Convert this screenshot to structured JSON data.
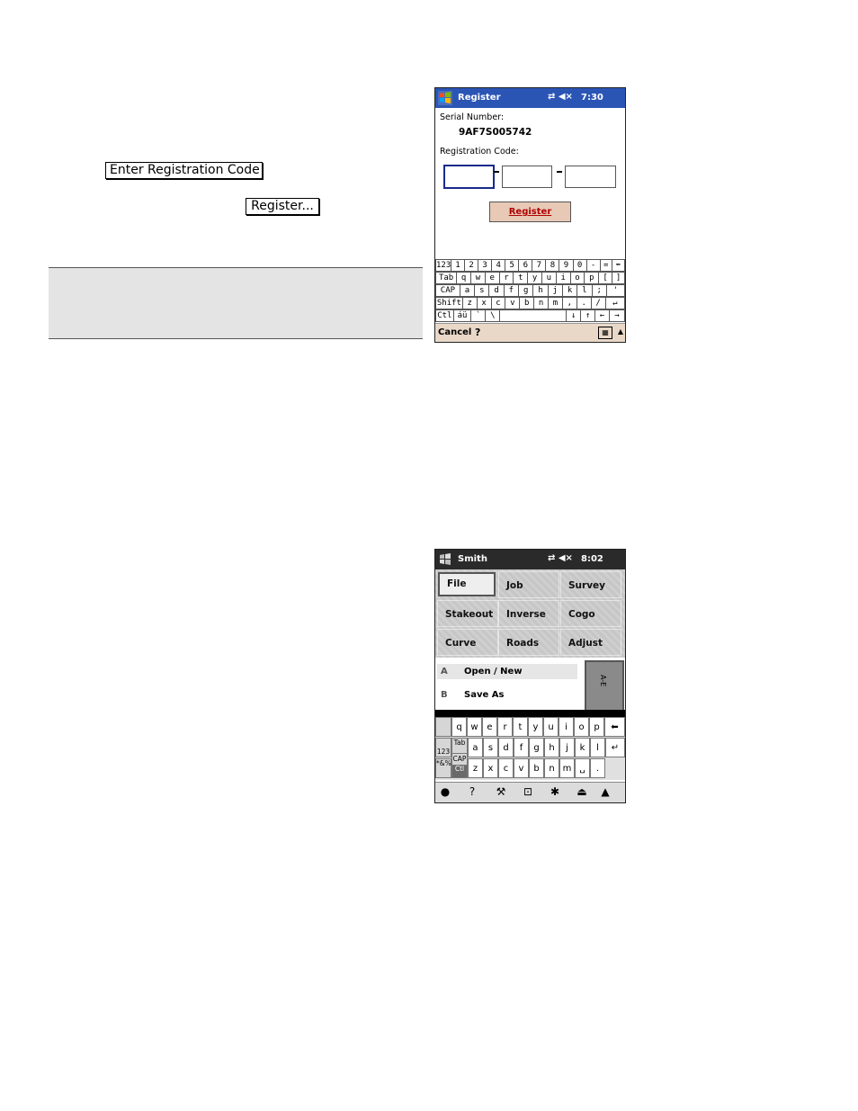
{
  "doc": {
    "enter_code_button": "Enter Registration Code",
    "register_button": "Register..."
  },
  "pda1": {
    "title": "Register",
    "icons": "⇄ ◀×",
    "time": "7:30",
    "serial_label": "Serial Number:",
    "serial_value": "9AF7S005742",
    "code_label": "Registration Code:",
    "register_button": "Register",
    "cancel": "Cancel",
    "keyboard": {
      "row1": [
        "123",
        "1",
        "2",
        "3",
        "4",
        "5",
        "6",
        "7",
        "8",
        "9",
        "0",
        "-",
        "=",
        "⬅"
      ],
      "row2": [
        "Tab",
        "q",
        "w",
        "e",
        "r",
        "t",
        "y",
        "u",
        "i",
        "o",
        "p",
        "[",
        "]"
      ],
      "row3": [
        "CAP",
        "a",
        "s",
        "d",
        "f",
        "g",
        "h",
        "j",
        "k",
        "l",
        ";",
        "'"
      ],
      "row4": [
        "Shift",
        "z",
        "x",
        "c",
        "v",
        "b",
        "n",
        "m",
        ",",
        ".",
        "/",
        "↵"
      ],
      "row5": [
        "Ctl",
        "áü",
        "`",
        "\\",
        "",
        "↓",
        "↑",
        "←",
        "→"
      ]
    }
  },
  "pda2": {
    "title": "Smith",
    "icons": "⇄ ◀×",
    "time": "8:02",
    "menu": [
      "File",
      "Job",
      "Survey",
      "Stakeout",
      "Inverse",
      "Cogo",
      "Curve",
      "Roads",
      "Adjust"
    ],
    "submenu": [
      {
        "key": "A",
        "label": "Open / New"
      },
      {
        "key": "B",
        "label": "Save As"
      }
    ],
    "side_tab": "A-E",
    "keyboard": {
      "row1": [
        "q",
        "w",
        "e",
        "r",
        "t",
        "y",
        "u",
        "i",
        "o",
        "p",
        "⬅"
      ],
      "row2_mod": [
        "123",
        "Tab"
      ],
      "row2": [
        "a",
        "s",
        "d",
        "f",
        "g",
        "h",
        "j",
        "k",
        "l",
        "↵"
      ],
      "row3_mod": [
        "CAP"
      ],
      "row3_mod2": [
        "*&%",
        "Ctl"
      ],
      "row3": [
        "z",
        "x",
        "c",
        "v",
        "b",
        "n",
        "m",
        "␣",
        "."
      ]
    }
  }
}
